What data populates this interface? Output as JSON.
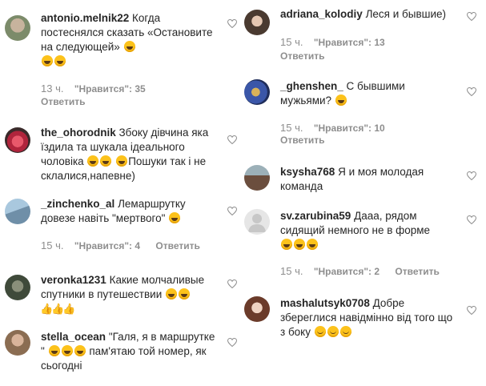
{
  "meta": {
    "likes_label": "\"Нравится\"",
    "reply_label": "Ответить"
  },
  "left": [
    {
      "username": "antonio.melnik22",
      "text": "Когда постеснялся сказать «Остановите на следующей»",
      "emoji_after": [
        "rofl-emoji",
        "rofl-emoji",
        "rofl-emoji"
      ],
      "age": "13 ч.",
      "likes": "35"
    },
    {
      "username": "the_ohorodnik",
      "text": "Збоку дівчина яка їздила та шукала ідеального чоловіка",
      "text2": "Пошуки так і не склалися,напевне)",
      "emoji_mid": [
        "grin-emoji",
        "grin-emoji",
        "grin-emoji"
      ]
    },
    {
      "username": "_zinchenko_al",
      "text": "Лемаршрутку довезе навіть \"мертвого\"",
      "emoji_after": [
        "grin-emoji"
      ],
      "age": "15 ч.",
      "likes": "4"
    },
    {
      "username": "veronka1231",
      "text": "Какие молчаливые спутники в путешествии",
      "emoji_after": [
        "grin-emoji",
        "grin-emoji"
      ],
      "thumbs": [
        "thumbs-up-emoji",
        "thumbs-up-emoji",
        "thumbs-up-emoji"
      ]
    },
    {
      "username": "stella_ocean",
      "text": "\"Галя, я в маршрутке \"",
      "emoji_mid": [
        "grin-emoji",
        "grin-emoji",
        "grin-emoji"
      ],
      "text2": "пам'ятаю той номер, як сьогодні"
    }
  ],
  "right": [
    {
      "username": "adriana_kolodiy",
      "text": "Леся и бывшие)",
      "age": "15 ч.",
      "likes": "13"
    },
    {
      "username": "_ghenshen_",
      "text": "С бывшими мужьями?",
      "emoji_after": [
        "grin-emoji"
      ],
      "age": "15 ч.",
      "likes": "10"
    },
    {
      "username": "ksysha768",
      "text": "Я и моя молодая команда"
    },
    {
      "username": "sv.zarubina59",
      "text": "Дааа, рядом сидящий немного не в форме",
      "emoji_after": [
        "grin-emoji",
        "grin-emoji",
        "grin-emoji"
      ],
      "age": "15 ч.",
      "likes": "2"
    },
    {
      "username": "mashalutsyk0708",
      "text": "Добре збереглися навідмінно від того що з боку",
      "emoji_after": [
        "smile-emoji",
        "smile-emoji",
        "smile-emoji"
      ]
    }
  ],
  "colors": {
    "text": "#262626",
    "muted": "#8e8e8e",
    "background": "#ffffff"
  }
}
